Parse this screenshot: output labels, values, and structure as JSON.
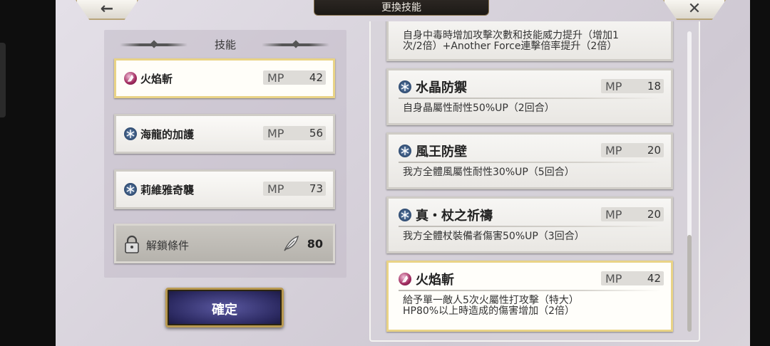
{
  "header": {
    "title": "更換技能",
    "back_icon": "←",
    "close_icon": "✕"
  },
  "left_panel": {
    "title": "技能",
    "skills": [
      {
        "name": "火焰斬",
        "mp_label": "MP",
        "mp": "42",
        "icon": "fire-element-icon",
        "selected": true
      },
      {
        "name": "海龍的加護",
        "mp_label": "MP",
        "mp": "56",
        "icon": "crystal-element-icon",
        "selected": false
      },
      {
        "name": "莉維雅奇襲",
        "mp_label": "MP",
        "mp": "73",
        "icon": "crystal-element-icon",
        "selected": false
      }
    ],
    "locked": {
      "label": "解鎖條件",
      "value": "80",
      "icon": "feather-icon"
    },
    "confirm_label": "確定"
  },
  "right_panel": {
    "cards": [
      {
        "name": "",
        "mp_label": "",
        "mp": "",
        "desc_line1": "自身中毒時增加攻擊次數和技能威力提升（增加1",
        "desc_line2": "次/2倍）+Another Force連擊倍率提升（2倍）",
        "partial": true
      },
      {
        "name": "水晶防禦",
        "mp_label": "MP",
        "mp": "18",
        "desc_line1": "自身晶屬性耐性50%UP（2回合）",
        "desc_line2": "",
        "icon": "crystal-element-icon"
      },
      {
        "name": "風王防壁",
        "mp_label": "MP",
        "mp": "20",
        "desc_line1": "我方全體風屬性耐性30%UP（5回合）",
        "desc_line2": "",
        "icon": "crystal-element-icon"
      },
      {
        "name": "真・杖之祈禱",
        "mp_label": "MP",
        "mp": "20",
        "desc_line1": "我方全體杖裝備者傷害50%UP（3回合）",
        "desc_line2": "",
        "icon": "crystal-element-icon"
      },
      {
        "name": "火焰斬",
        "mp_label": "MP",
        "mp": "42",
        "desc_line1": "給予單一敵人5次火屬性打攻擊（特大）",
        "desc_line2": "HP80%以上時造成的傷害增加（2倍）",
        "icon": "fire-element-icon",
        "selected": true
      }
    ]
  },
  "colors": {
    "selected_border": "#e9d386",
    "confirm_bg": "#2c2a62",
    "confirm_border": "#b99a52",
    "crystal_icon": "#2e4a70",
    "fire_icon": "#a02a5e"
  }
}
